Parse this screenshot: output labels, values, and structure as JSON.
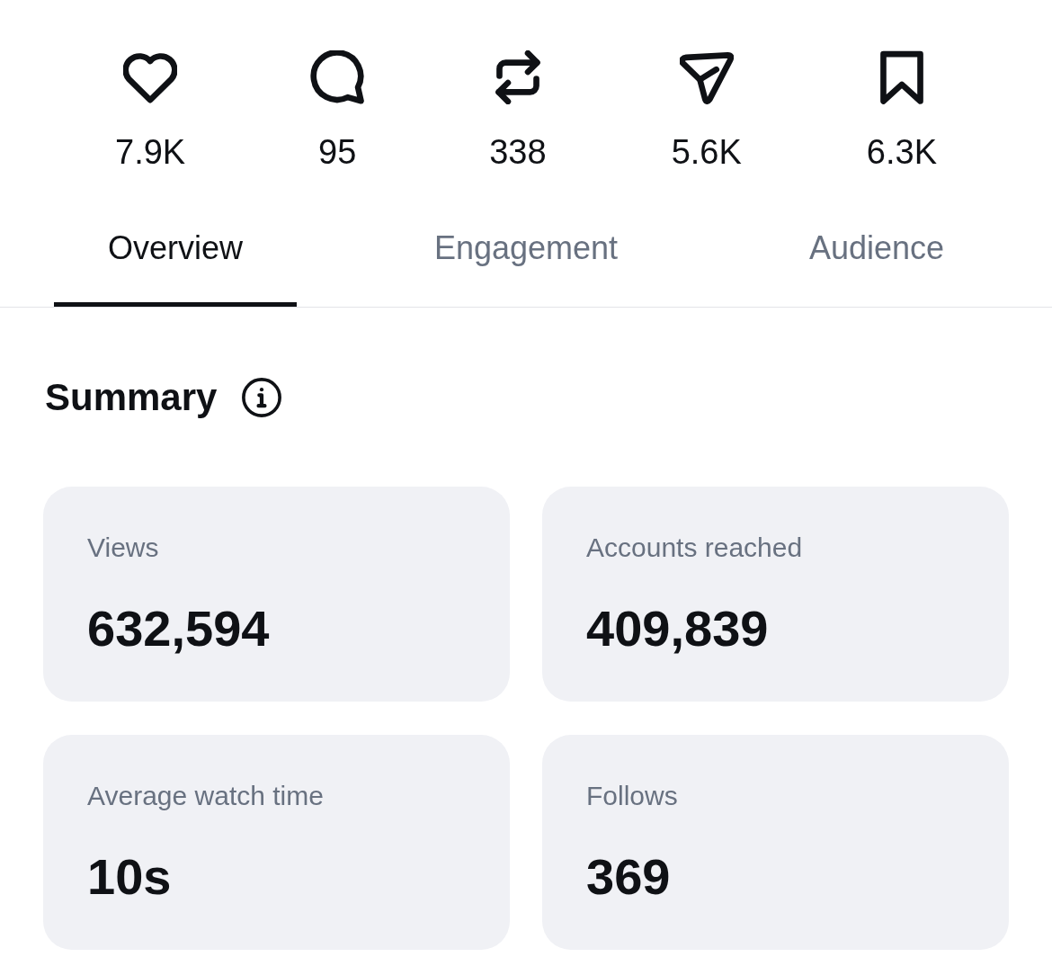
{
  "stats": [
    {
      "kind": "like",
      "value": "7.9K"
    },
    {
      "kind": "comment",
      "value": "95"
    },
    {
      "kind": "repost",
      "value": "338"
    },
    {
      "kind": "share",
      "value": "5.6K"
    },
    {
      "kind": "save",
      "value": "6.3K"
    }
  ],
  "tabs": [
    {
      "label": "Overview",
      "selected": true
    },
    {
      "label": "Engagement",
      "selected": false
    },
    {
      "label": "Audience",
      "selected": false
    }
  ],
  "summary": {
    "title": "Summary"
  },
  "cards": [
    {
      "label": "Views",
      "value": "632,594"
    },
    {
      "label": "Accounts reached",
      "value": "409,839"
    },
    {
      "label": "Average watch time",
      "value": "10s"
    },
    {
      "label": "Follows",
      "value": "369"
    }
  ]
}
